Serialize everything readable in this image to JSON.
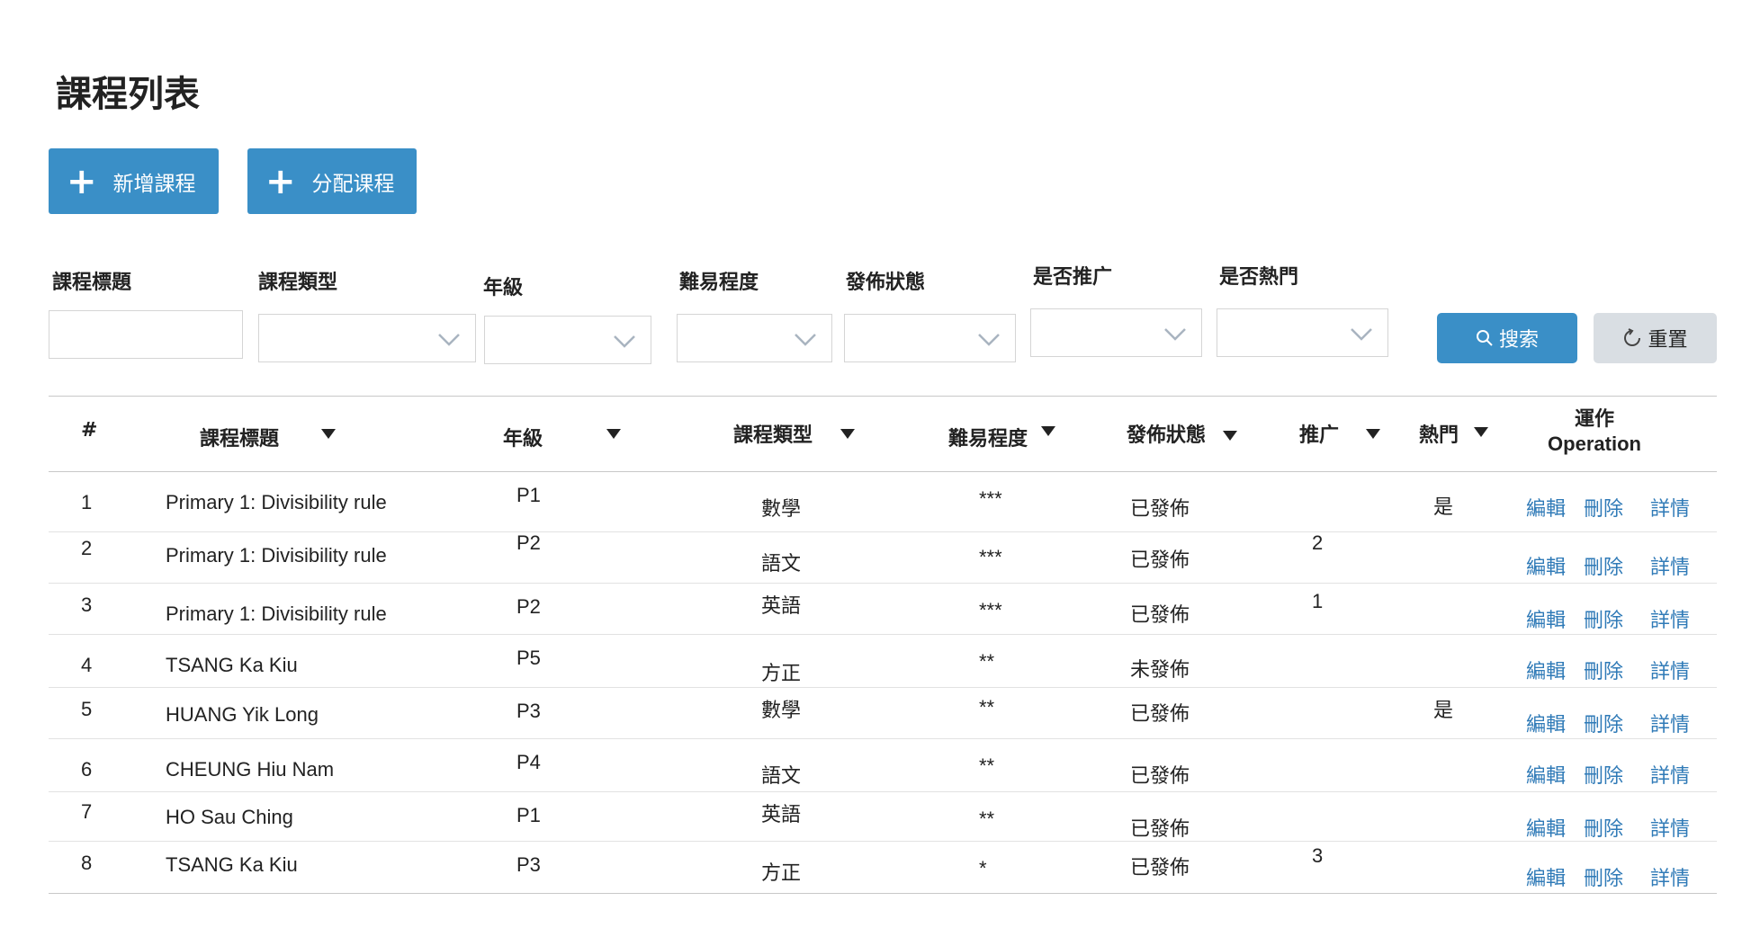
{
  "page": {
    "title": "課程列表"
  },
  "toolbar": {
    "add_label": "新增課程",
    "assign_label": "分配课程"
  },
  "filters": {
    "course_title": "課程標題",
    "course_type": "課程類型",
    "grade": "年級",
    "difficulty": "難易程度",
    "publish_status": "發佈狀態",
    "is_promoted": "是否推广",
    "is_popular": "是否熱門",
    "search_label": "搜索",
    "reset_label": "重置"
  },
  "table": {
    "headers": {
      "index": "#",
      "title": "課程標題",
      "grade": "年級",
      "type": "課程類型",
      "difficulty": "難易程度",
      "status": "發佈狀態",
      "promote": "推广",
      "popular": "熱門",
      "operation_zh": "運作",
      "operation_en": "Operation"
    },
    "actions": {
      "edit": "編輯",
      "delete": "刪除",
      "detail": "詳情"
    },
    "rows": [
      {
        "idx": "1",
        "title": "Primary 1: Divisibility rule",
        "grade": "P1",
        "type": "數學",
        "difficulty": "***",
        "status": "已發佈",
        "promote": "",
        "popular": "是"
      },
      {
        "idx": "2",
        "title": "Primary 1: Divisibility rule",
        "grade": "P2",
        "type": "語文",
        "difficulty": "***",
        "status": "已發佈",
        "promote": "2",
        "popular": ""
      },
      {
        "idx": "3",
        "title": "Primary 1: Divisibility rule",
        "grade": "P2",
        "type": "英語",
        "difficulty": "***",
        "status": "已發佈",
        "promote": "1",
        "popular": ""
      },
      {
        "idx": "4",
        "title": "TSANG Ka Kiu",
        "grade": "P5",
        "type": "方正",
        "difficulty": "**",
        "status": "未發佈",
        "promote": "",
        "popular": ""
      },
      {
        "idx": "5",
        "title": "HUANG Yik Long",
        "grade": "P3",
        "type": "數學",
        "difficulty": "**",
        "status": "已發佈",
        "promote": "",
        "popular": "是"
      },
      {
        "idx": "6",
        "title": "CHEUNG Hiu Nam",
        "grade": "P4",
        "type": "語文",
        "difficulty": "**",
        "status": "已發佈",
        "promote": "",
        "popular": ""
      },
      {
        "idx": "7",
        "title": "HO Sau Ching",
        "grade": "P1",
        "type": "英語",
        "difficulty": "**",
        "status": "已發佈",
        "promote": "",
        "popular": ""
      },
      {
        "idx": "8",
        "title": "TSANG Ka Kiu",
        "grade": "P3",
        "type": "方正",
        "difficulty": "*",
        "status": "已發佈",
        "promote": "3",
        "popular": ""
      }
    ]
  },
  "colors": {
    "primary": "#3a8fc7",
    "link": "#2f7ab7",
    "reset_bg": "#d9dee3"
  }
}
